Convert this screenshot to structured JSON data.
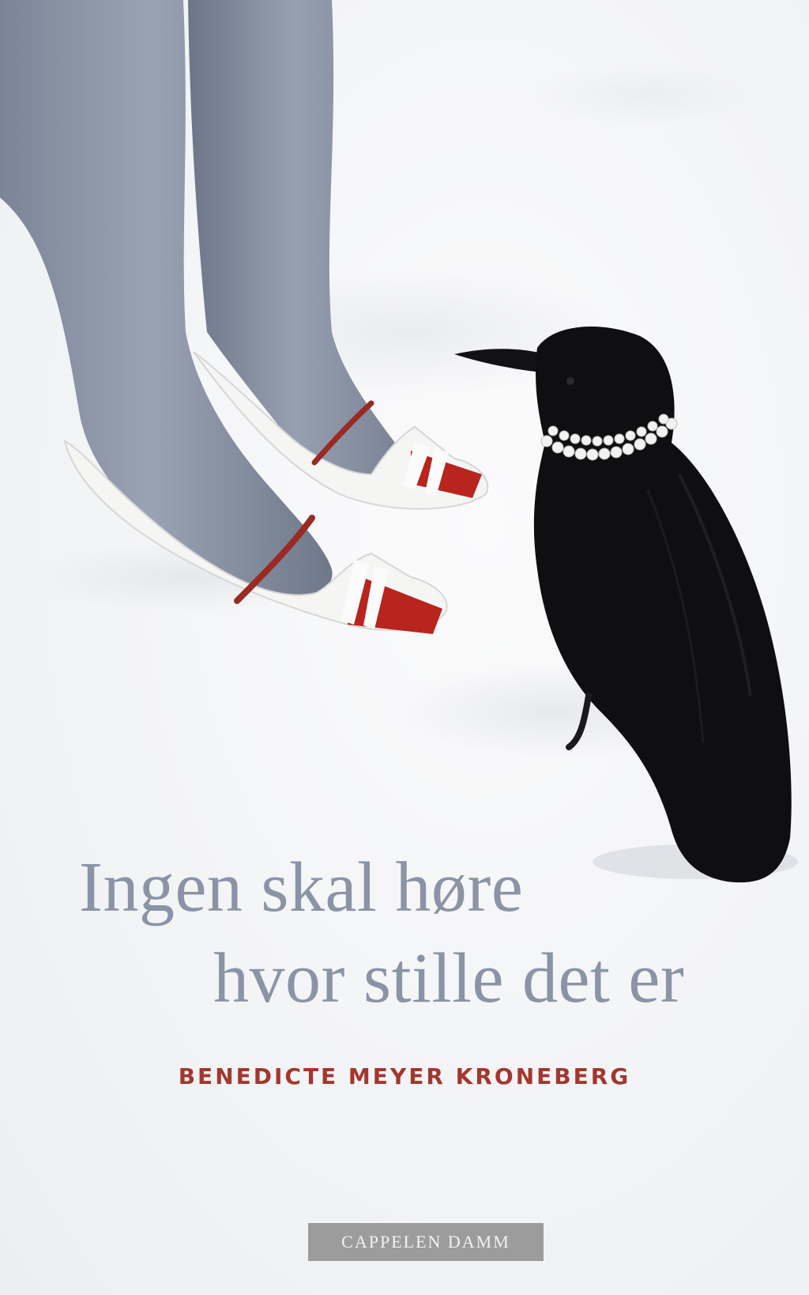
{
  "book": {
    "title_line_1": "Ingen skal høre",
    "title_line_2": "hvor stille det er",
    "author": "BENEDICTE MEYER KRONEBERG",
    "publisher": "CAPPELEN DAMM"
  },
  "colors": {
    "title": "#8a94a6",
    "author": "#a3372e",
    "publisher_band": "#9c9c9c",
    "snow": "#f3f4f6",
    "tights": "#8f98aa",
    "crow": "#0f0f12"
  },
  "illustration": {
    "subjects": [
      "legs-in-grey-tights",
      "white-shoes-with-red-stripes",
      "black-crow-with-pearl-necklace",
      "snow"
    ]
  }
}
